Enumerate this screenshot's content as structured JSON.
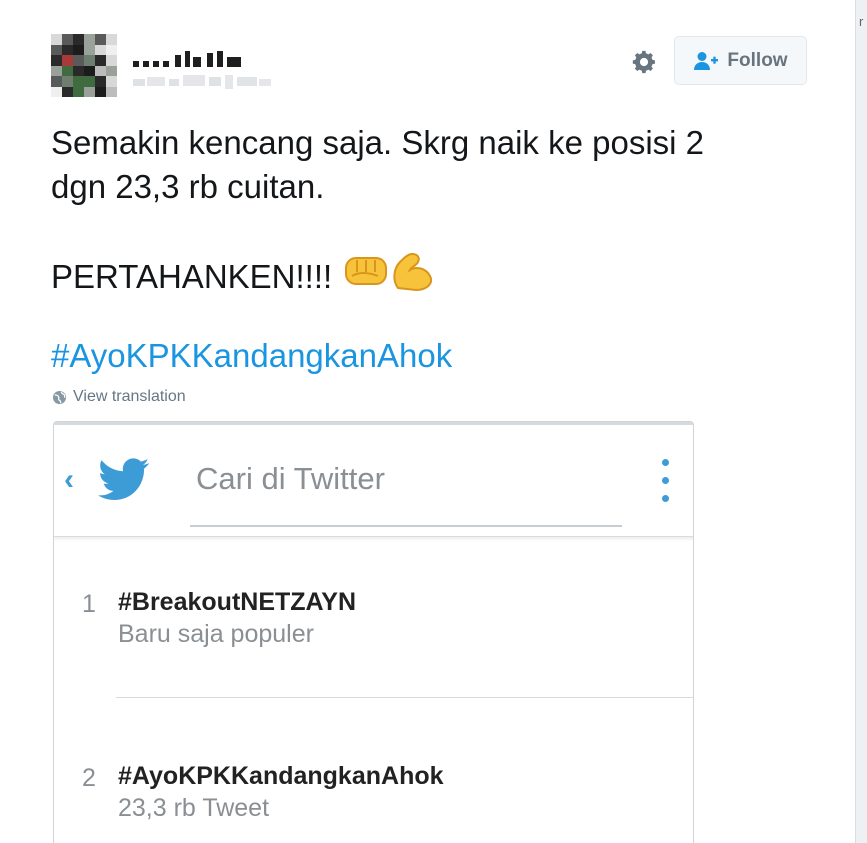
{
  "header": {
    "follow_label": "Follow"
  },
  "tweet": {
    "line1": "Semakin kencang saja. Skrg naik ke posisi 2",
    "line2": "dgn 23,3 rb cuitan.",
    "line3": "PERTAHANKEN!!!!",
    "emojis": [
      "oncoming-fist-emoji",
      "flexed-biceps-emoji"
    ],
    "hashtag": "#AyoKPKKandangkanAhok",
    "translate_label": "View translation"
  },
  "embed": {
    "search_placeholder": "Cari di Twitter",
    "accent_color": "#3d9bd6",
    "trends": [
      {
        "rank": "1",
        "tag": "#BreakoutNETZAYN",
        "sub": "Baru saja populer"
      },
      {
        "rank": "2",
        "tag": "#AyoKPKKandangkanAhok",
        "sub": "23,3 rb Tweet"
      }
    ]
  },
  "colors": {
    "link": "#1b95e0",
    "text": "#14171a",
    "muted": "#657786"
  }
}
